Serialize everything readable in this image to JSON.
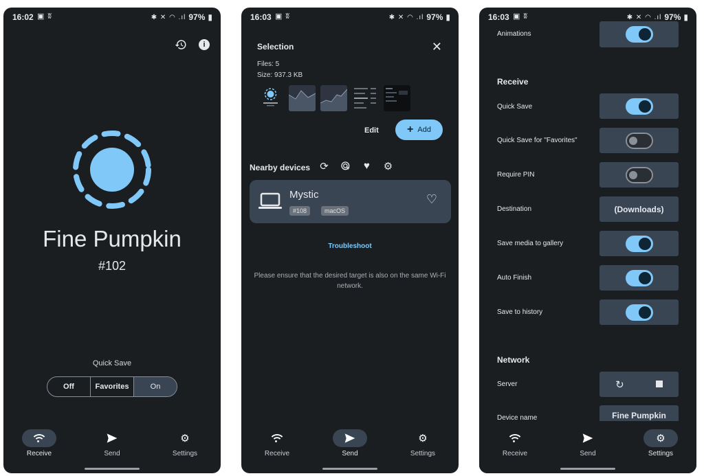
{
  "status": {
    "p1_time": "16:02",
    "p2_time": "16:03",
    "p3_time": "16:03",
    "battery": "97%"
  },
  "nav": {
    "receive": "Receive",
    "send": "Send",
    "settings": "Settings"
  },
  "receive_screen": {
    "device_name": "Fine Pumpkin",
    "device_number": "#102",
    "quick_save_label": "Quick Save",
    "options": [
      "Off",
      "Favorites",
      "On"
    ],
    "selected_option": "On"
  },
  "send_screen": {
    "selection_title": "Selection",
    "files": "Files: 5",
    "size": "Size: 937.3 KB",
    "edit_label": "Edit",
    "add_label": "Add",
    "nearby_title": "Nearby devices",
    "device": {
      "name": "Mystic",
      "badges": [
        "#108",
        "macOS"
      ]
    },
    "troubleshoot": "Troubleshoot",
    "hint": "Please ensure that the desired target is also on the same Wi-Fi network."
  },
  "settings_screen": {
    "animations": {
      "label": "Animations",
      "on": true
    },
    "receive_title": "Receive",
    "quick_save": {
      "label": "Quick Save",
      "on": true
    },
    "quick_save_fav": {
      "label": "Quick Save for \"Favorites\"",
      "on": false
    },
    "require_pin": {
      "label": "Require PIN",
      "on": false
    },
    "destination": {
      "label": "Destination",
      "value": "(Downloads)"
    },
    "save_media": {
      "label": "Save media to gallery",
      "on": true
    },
    "auto_finish": {
      "label": "Auto Finish",
      "on": true
    },
    "save_history": {
      "label": "Save to history",
      "on": true
    },
    "network_title": "Network",
    "server_label": "Server",
    "device_name": {
      "label": "Device name",
      "value": "Fine Pumpkin"
    }
  },
  "colors": {
    "background": "#1b1e21",
    "surface": "#3a4553",
    "accent": "#7fc8f8"
  }
}
